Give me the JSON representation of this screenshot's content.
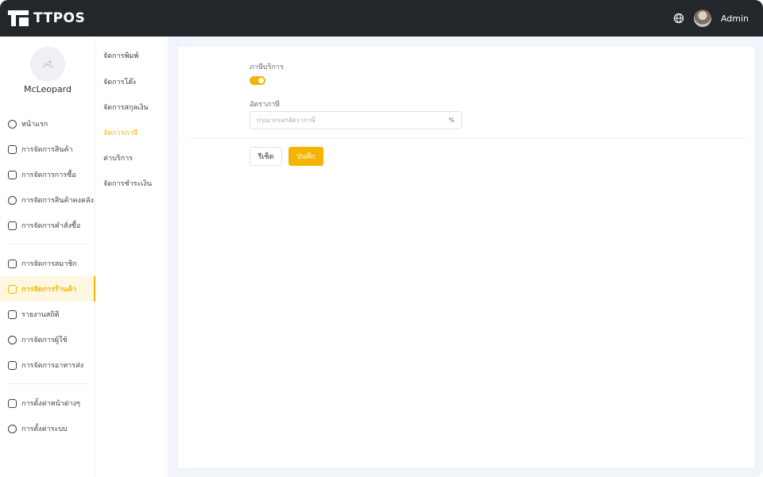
{
  "app": {
    "brand": "TTPOS",
    "user": "Admin"
  },
  "profile": {
    "name": "McLeopard"
  },
  "sidebar": {
    "items": [
      {
        "label": "หน้าแรก",
        "icon": "dashboard-icon"
      },
      {
        "label": "การจัดการสินค้า",
        "icon": "cube-icon"
      },
      {
        "label": "การจัดการการซื้อ",
        "icon": "cart-icon"
      },
      {
        "label": "การจัดการสินค้าคงคลัง",
        "icon": "inventory-icon"
      },
      {
        "label": "การจัดการคำสั่งซื้อ",
        "icon": "clipboard-icon"
      },
      {
        "label": "การจัดการสมาชิก",
        "icon": "member-icon"
      },
      {
        "label": "การจัดการร้านค้า",
        "icon": "store-icon",
        "active": true
      },
      {
        "label": "รายงานสถิติ",
        "icon": "report-icon"
      },
      {
        "label": "การจัดการผู้ใช้",
        "icon": "users-icon"
      },
      {
        "label": "การจัดการอาหารส่ง",
        "icon": "delivery-icon"
      },
      {
        "label": "การตั้งค่าหน้าต่างๆ",
        "icon": "page-settings-icon"
      },
      {
        "label": "การตั้งค่าระบบ",
        "icon": "gear-icon"
      }
    ]
  },
  "submenu": {
    "items": [
      {
        "label": "จัดการพิมพ์"
      },
      {
        "label": "จัดการโต๊ะ"
      },
      {
        "label": "จัดการสกุลเงิน"
      },
      {
        "label": "จัดการภาษี",
        "active": true
      },
      {
        "label": "ค่าบริการ"
      },
      {
        "label": "จัดการชำระเงิน"
      }
    ]
  },
  "form": {
    "service_tax_label": "ภาษีบริการ",
    "service_tax_enabled": true,
    "tax_rate_label": "อัตราภาษี",
    "tax_rate_placeholder": "กรุณากรอกอัตราภาษี",
    "tax_rate_value": "",
    "tax_rate_suffix": "%",
    "reset_label": "รีเซ็ต",
    "save_label": "บันทึก"
  },
  "colors": {
    "accent": "#f5b400",
    "topbar": "#23272c",
    "background": "#f1f5fb"
  }
}
